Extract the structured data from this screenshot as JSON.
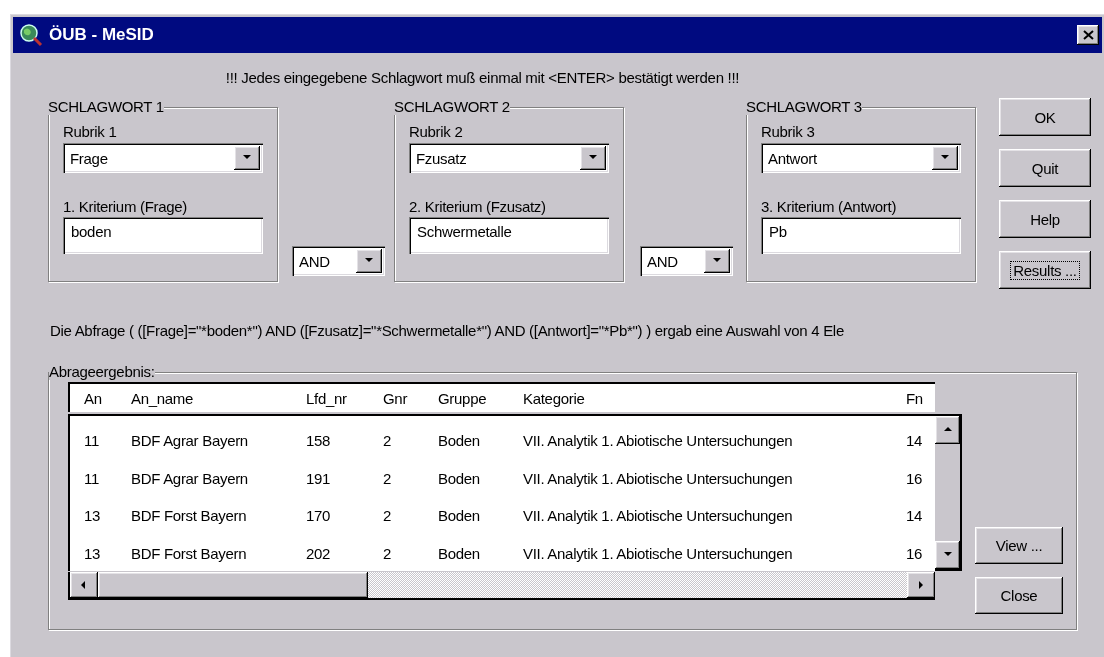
{
  "window": {
    "title": "ÖUB - MeSID"
  },
  "notice": "!!! Jedes eingegebene Schlagwort muß einmal mit <ENTER> bestätigt werden !!!",
  "keywords": [
    {
      "group": "SCHLAGWORT 1",
      "rubric_label": "Rubrik 1",
      "rubric": "Frage",
      "criterion_label": "1. Kriterium (Frage)",
      "criterion": "boden"
    },
    {
      "group": "SCHLAGWORT 2",
      "rubric_label": "Rubrik 2",
      "rubric": "Fzusatz",
      "criterion_label": "2. Kriterium (Fzusatz)",
      "criterion": "Schwermetalle"
    },
    {
      "group": "SCHLAGWORT 3",
      "rubric_label": "Rubrik 3",
      "rubric": "Antwort",
      "criterion_label": "3. Kriterium (Antwort)",
      "criterion": "Pb"
    }
  ],
  "operators": [
    "AND",
    "AND"
  ],
  "buttons": [
    {
      "label": "OK",
      "focused": false
    },
    {
      "label": "Quit",
      "focused": false
    },
    {
      "label": "Help",
      "focused": false
    },
    {
      "label": "Results ...",
      "focused": true
    }
  ],
  "query": "Die Abfrage ( ([Frage]=\"*boden*\") AND ([Fzusatz]=\"*Schwermetalle*\") AND ([Antwort]=\"*Pb*\") ) ergab eine Auswahl von 4 Ele",
  "results": {
    "label": "Abrageergebnis:",
    "columns": [
      "An",
      "An_name",
      "Lfd_nr",
      "Gnr",
      "Gruppe",
      "Kategorie",
      "Fn"
    ],
    "rows": [
      [
        "11",
        "BDF Agrar Bayern",
        "158",
        "2",
        "Boden",
        "VII. Analytik  1. Abiotische Untersuchungen",
        "14"
      ],
      [
        "11",
        "BDF Agrar Bayern",
        "191",
        "2",
        "Boden",
        "VII. Analytik  1. Abiotische Untersuchungen",
        "16"
      ],
      [
        "13",
        "BDF Forst Bayern",
        "170",
        "2",
        "Boden",
        "VII. Analytik  1. Abiotische Untersuchungen",
        "14"
      ],
      [
        "13",
        "BDF Forst Bayern",
        "202",
        "2",
        "Boden",
        "VII. Analytik  1. Abiotische Untersuchungen",
        "16"
      ]
    ]
  },
  "actions": [
    "View ...",
    "Close"
  ]
}
